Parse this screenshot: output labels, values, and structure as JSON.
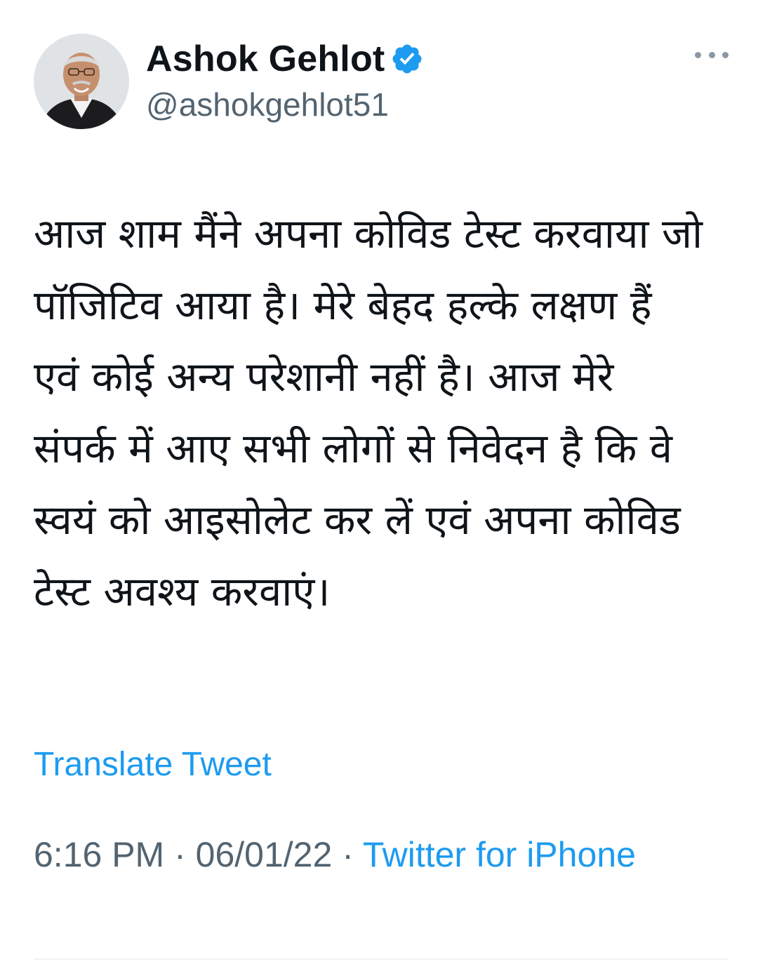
{
  "author": {
    "display_name": "Ashok Gehlot",
    "handle": "@ashokgehlot51",
    "verified": true,
    "verified_color": "#1d9bf0"
  },
  "tweet": {
    "text": "आज शाम मैंने अपना कोविड टेस्ट करवाया जो पॉजिटिव आया है। मेरे बेहद हल्के लक्षण हैं एवं कोई अन्य परेशानी नहीं है। आज मेरे संपर्क में आए सभी लोगों से निवेदन है कि वे स्वयं को आइसोलेट कर लें एवं अपना कोविड टेस्ट अवश्य करवाएं।",
    "translate_label": "Translate Tweet",
    "time": "6:16 PM",
    "separator": " · ",
    "date": "06/01/22",
    "source": "Twitter for iPhone"
  },
  "icons": {
    "more": "more-horizontal-icon",
    "verified": "verified-badge-icon"
  },
  "colors": {
    "accent": "#1d9bf0",
    "text_primary": "#0f1419",
    "text_secondary": "#536471"
  }
}
